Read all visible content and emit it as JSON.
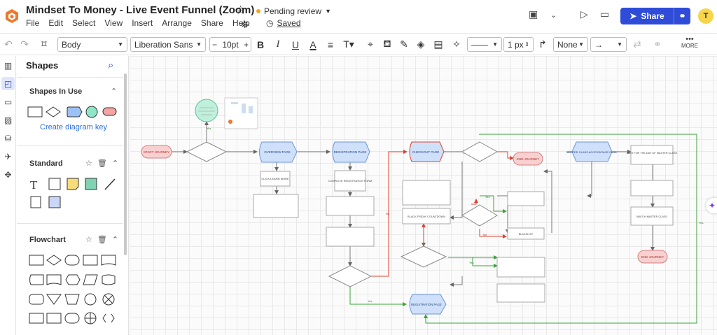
{
  "header": {
    "title": "Mindset To Money - Live Event Funnel (Zoom)",
    "status": "Pending review",
    "saved": "Saved",
    "share": "Share",
    "avatar": "T"
  },
  "menu": [
    "File",
    "Edit",
    "Select",
    "View",
    "Insert",
    "Arrange",
    "Share",
    "Help"
  ],
  "toolbar": {
    "style": "Body",
    "font": "Liberation Sans",
    "font_size": "10pt",
    "stroke_width": "1 px",
    "arrow_start": "None",
    "more": "MORE"
  },
  "panel": {
    "title": "Shapes",
    "sections": {
      "in_use": "Shapes In Use",
      "standard": "Standard",
      "flowchart": "Flowchart"
    },
    "create_key": "Create diagram key"
  },
  "colors": {
    "accent": "#2f4cd8",
    "start_end_fill": "#f8d0d0",
    "page_fill": "#cfe0fb",
    "success_fill": "#bff0dc",
    "yes_line": "#3aa33a",
    "no_line": "#e0422e"
  },
  "diagram": {
    "start": "START JOURNEY",
    "end": "END JOURNEY",
    "yes": "Yes",
    "no": "No",
    "pages": {
      "overview": "OVERVIEW PAGE",
      "registration": "REGISTRATION PAGE",
      "checkout": "CHECKOUT PAGE",
      "masterclass": "MASTER CLASS ACCESS/PAGE PAGE",
      "thankyou": "REGISTRATION PAGE"
    },
    "steps": {
      "click_learn": "CLICK LEARN MORE",
      "complete_reg": "COMPLETE REGISTRATION FORM",
      "wait_day": "WAIT FOR THE DAY OF MASTER CLASS",
      "watch": "WATCH MASTER CLASS",
      "blackfriday": "BLACK FRIDAY COUNTDOWN",
      "blacklist": "BLACKLIST"
    }
  }
}
